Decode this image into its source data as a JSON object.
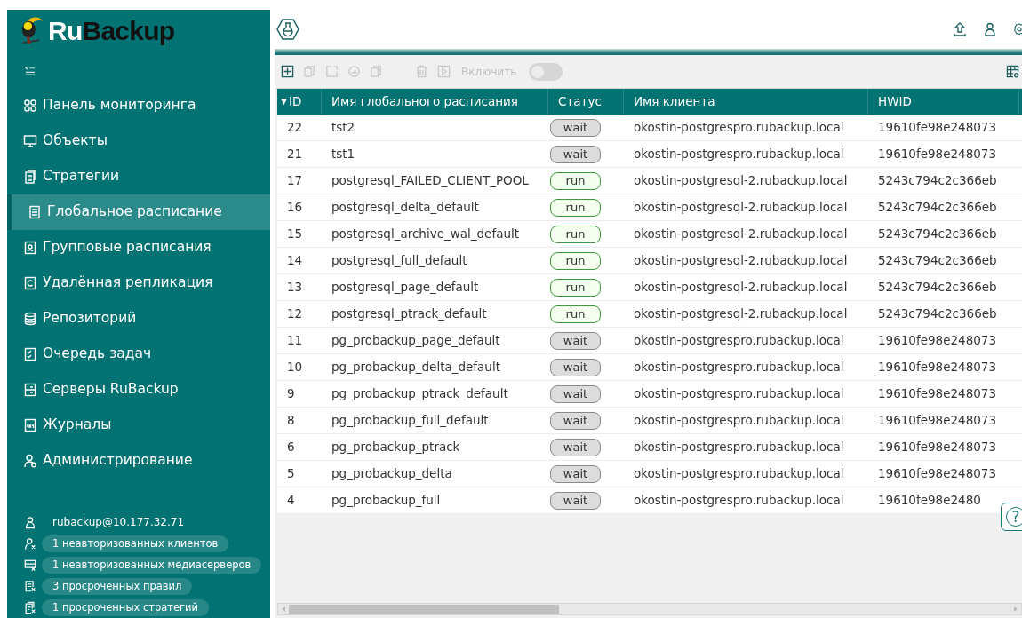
{
  "sidebar": {
    "logo": {
      "part_1": "Ru",
      "part_2": "Backup"
    },
    "items": [
      {
        "label": "Панель мониторинга",
        "kind": "grid",
        "selected": false
      },
      {
        "label": "Объекты",
        "kind": "monitor",
        "selected": false
      },
      {
        "label": "Стратегии",
        "kind": "docs",
        "selected": false
      },
      {
        "label": "Глобальное расписание",
        "kind": "doc",
        "selected": true
      },
      {
        "label": "Групповые расписания",
        "kind": "group",
        "selected": false
      },
      {
        "label": "Удалённая репликация",
        "kind": "replica",
        "selected": false
      },
      {
        "label": "Репозиторий",
        "kind": "db",
        "selected": false
      },
      {
        "label": "Очередь задач",
        "kind": "queue",
        "selected": false
      },
      {
        "label": "Серверы RuBackup",
        "kind": "server",
        "selected": false
      },
      {
        "label": "Журналы",
        "kind": "log",
        "selected": false
      },
      {
        "label": "Администрирование",
        "kind": "admin",
        "selected": false
      }
    ],
    "user": "rubackup@10.177.32.71",
    "alerts": [
      {
        "label": "1 неавторизованных клиентов",
        "kind": "user-x"
      },
      {
        "label": "1 неавторизованных медиасерверов",
        "kind": "server-x"
      },
      {
        "label": "3 просроченных правил",
        "kind": "doc-x"
      },
      {
        "label": "1 просроченных стратегий",
        "kind": "docs-x"
      }
    ]
  },
  "toolbar": {
    "buttons": [
      {
        "kind": "add",
        "disabled": false
      },
      {
        "kind": "copy",
        "disabled": true
      },
      {
        "kind": "edit",
        "disabled": true
      },
      {
        "kind": "gauge",
        "disabled": true
      },
      {
        "kind": "clone",
        "disabled": true
      },
      {
        "kind": "delete",
        "disabled": true
      },
      {
        "kind": "run",
        "disabled": true
      }
    ],
    "toggle": {
      "label": "Включить",
      "on": false,
      "disabled": true
    }
  },
  "table": {
    "columns": [
      {
        "label": "ID",
        "sort_indicator": "▼"
      },
      {
        "label": "Имя глобального расписания"
      },
      {
        "label": "Статус"
      },
      {
        "label": "Имя клиента"
      },
      {
        "label": "HWID"
      }
    ],
    "rows": [
      {
        "id": "22",
        "name": "tst2",
        "status": "wait",
        "client": "okostin-postgrespro.rubackup.local",
        "hwid": "19610fe98e248073"
      },
      {
        "id": "21",
        "name": "tst1",
        "status": "wait",
        "client": "okostin-postgrespro.rubackup.local",
        "hwid": "19610fe98e248073"
      },
      {
        "id": "17",
        "name": "postgresql_FAILED_CLIENT_POOL",
        "status": "run",
        "client": "okostin-postgresql-2.rubackup.local",
        "hwid": "5243c794c2c366eb"
      },
      {
        "id": "16",
        "name": "postgresql_delta_default",
        "status": "run",
        "client": "okostin-postgresql-2.rubackup.local",
        "hwid": "5243c794c2c366eb"
      },
      {
        "id": "15",
        "name": "postgresql_archive_wal_default",
        "status": "run",
        "client": "okostin-postgresql-2.rubackup.local",
        "hwid": "5243c794c2c366eb"
      },
      {
        "id": "14",
        "name": "postgresql_full_default",
        "status": "run",
        "client": "okostin-postgresql-2.rubackup.local",
        "hwid": "5243c794c2c366eb"
      },
      {
        "id": "13",
        "name": "postgresql_page_default",
        "status": "run",
        "client": "okostin-postgresql-2.rubackup.local",
        "hwid": "5243c794c2c366eb"
      },
      {
        "id": "12",
        "name": "postgresql_ptrack_default",
        "status": "run",
        "client": "okostin-postgresql-2.rubackup.local",
        "hwid": "5243c794c2c366eb"
      },
      {
        "id": "11",
        "name": "pg_probackup_page_default",
        "status": "wait",
        "client": "okostin-postgrespro.rubackup.local",
        "hwid": "19610fe98e248073"
      },
      {
        "id": "10",
        "name": "pg_probackup_delta_default",
        "status": "wait",
        "client": "okostin-postgrespro.rubackup.local",
        "hwid": "19610fe98e248073"
      },
      {
        "id": "9",
        "name": "pg_probackup_ptrack_default",
        "status": "wait",
        "client": "okostin-postgrespro.rubackup.local",
        "hwid": "19610fe98e248073"
      },
      {
        "id": "8",
        "name": "pg_probackup_full_default",
        "status": "wait",
        "client": "okostin-postgrespro.rubackup.local",
        "hwid": "19610fe98e248073"
      },
      {
        "id": "6",
        "name": "pg_probackup_ptrack",
        "status": "wait",
        "client": "okostin-postgrespro.rubackup.local",
        "hwid": "19610fe98e248073"
      },
      {
        "id": "5",
        "name": "pg_probackup_delta",
        "status": "wait",
        "client": "okostin-postgrespro.rubackup.local",
        "hwid": "19610fe98e248073"
      },
      {
        "id": "4",
        "name": "pg_probackup_full",
        "status": "wait",
        "client": "okostin-postgrespro.rubackup.local",
        "hwid": "19610fe98e2480"
      }
    ]
  },
  "help_button": "?"
}
